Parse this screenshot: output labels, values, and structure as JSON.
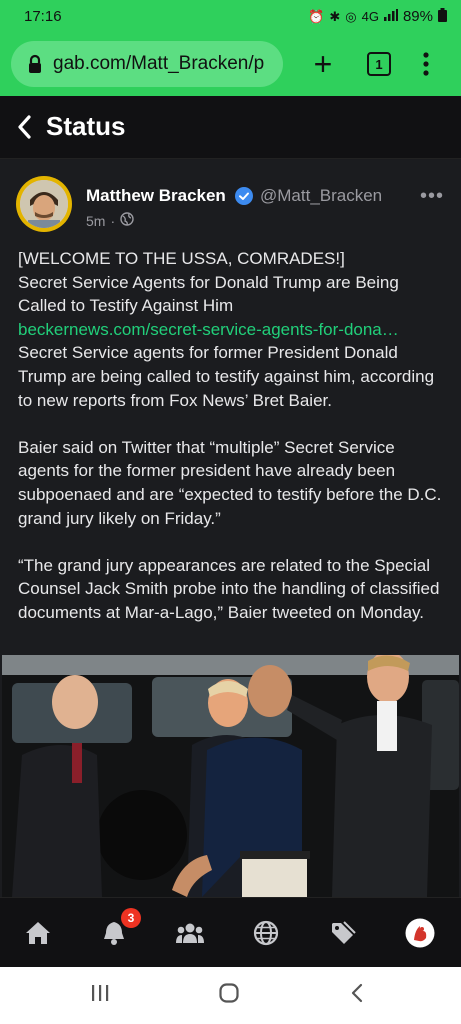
{
  "status_bar": {
    "time": "17:16",
    "network": "4G",
    "battery": "89%",
    "icons": [
      "alarm-icon",
      "bluetooth-icon",
      "hotspot-icon",
      "network-4g-icon",
      "signal-icon",
      "battery-icon"
    ]
  },
  "browser": {
    "url": "gab.com/Matt_Bracken/p",
    "tab_count": "1",
    "new_tab_label": "+"
  },
  "header": {
    "title": "Status"
  },
  "post": {
    "author_name": "Matthew Bracken",
    "handle": "@Matt_Bracken",
    "time": "5m",
    "separator": "·",
    "more": "•••",
    "text_lines": [
      "[WELCOME TO THE USSA, COMRADES!]",
      "Secret Service Agents for Donald Trump are Being Called to Testify Against Him"
    ],
    "link": "beckernews.com/secret-service-agents-for-dona…",
    "paragraph1": "Secret Service agents for former President Donald Trump are being called to testify against him, according to new reports from Fox News’ Bret Baier.",
    "paragraph2": "Baier said on Twitter that “multiple” Secret Service agents for the former president have already been subpoenaed and are “expected to testify before the D.C. grand jury likely on Friday.”",
    "paragraph3": "“The grand jury appearances are related to the Special Counsel Jack Smith probe into the handling of classified documents at Mar-a-Lago,” Baier tweeted on Monday."
  },
  "bottom_nav": {
    "items": [
      "home-icon",
      "notifications-icon",
      "groups-icon",
      "explore-icon",
      "tags-icon",
      "profile-avatar"
    ],
    "notification_count": "3"
  },
  "colors": {
    "chrome_green": "#2fd05c",
    "link_green": "#21cf7a",
    "verified_blue": "#3d8bf0",
    "badge_red": "#ee3322"
  }
}
